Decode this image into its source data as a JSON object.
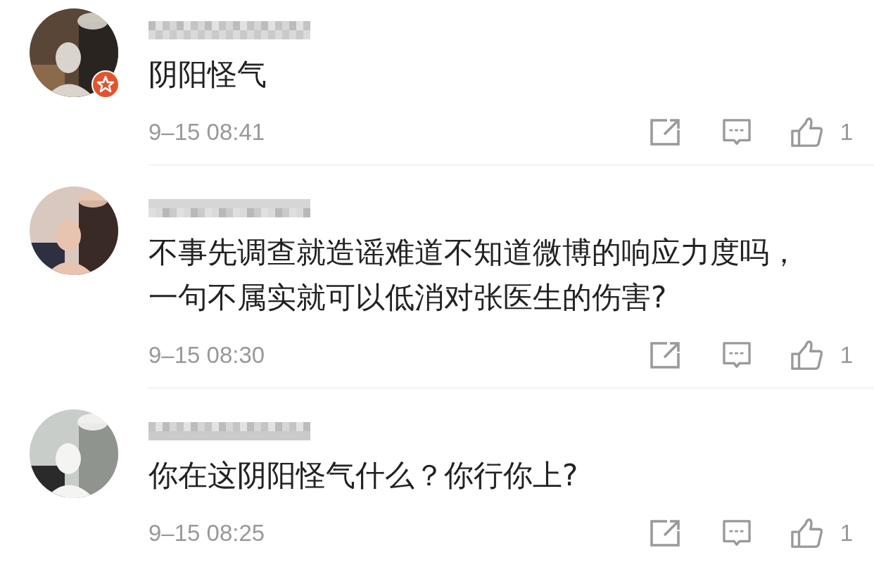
{
  "comments": [
    {
      "verified": true,
      "text": "阴阳怪气",
      "time": "9–15 08:41",
      "likes": "1"
    },
    {
      "verified": false,
      "text": "不事先调查就造谣难道不知道微博的响应力度吗，一句不属实就可以低消对张医生的伤害?",
      "time": "9–15 08:30",
      "likes": "1"
    },
    {
      "verified": false,
      "text": "你在这阴阳怪气什么？你行你上?",
      "time": "9–15 08:25",
      "likes": "1"
    }
  ]
}
